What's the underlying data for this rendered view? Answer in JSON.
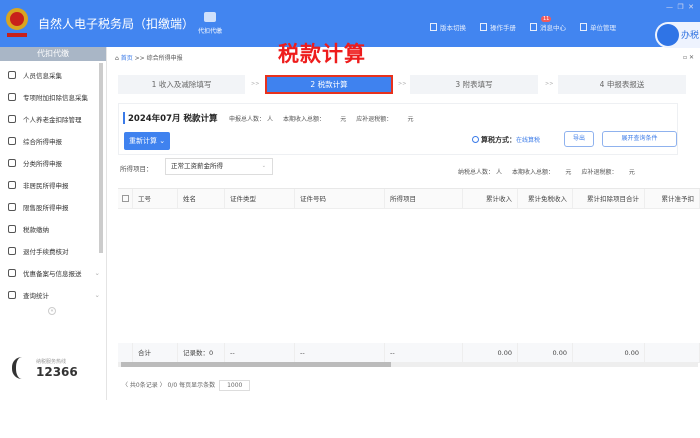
{
  "header": {
    "app_title": "自然人电子税务局（扣缴端）",
    "nav_button": "代扣代缴",
    "links": [
      "版本切换",
      "操作手册",
      "消息中心",
      "单位管理"
    ],
    "message_badge": "11",
    "chat_label": "办税",
    "brand_color": "#4285f0"
  },
  "sidebar": {
    "title": "代扣代缴",
    "items": [
      {
        "label": "人员信息采集",
        "icon": "person-icon"
      },
      {
        "label": "专项附加扣除信息采集",
        "icon": "list-icon"
      },
      {
        "label": "个人养老金扣除管理",
        "icon": "card-icon"
      },
      {
        "label": "综合所得申报",
        "icon": "layers-icon"
      },
      {
        "label": "分类所得申报",
        "icon": "pie-icon"
      },
      {
        "label": "非居民所得申报",
        "icon": "user-icon"
      },
      {
        "label": "限售股所得申报",
        "icon": "chart-icon"
      },
      {
        "label": "税款缴纳",
        "icon": "folder-icon"
      },
      {
        "label": "退付手续费核对",
        "icon": "book-icon"
      },
      {
        "label": "优惠备案与信息报送",
        "icon": "doc-icon"
      },
      {
        "label": "查询统计",
        "icon": "search-icon"
      }
    ],
    "hotline_label": "纳税服务热线",
    "hotline": "12366"
  },
  "breadcrumb": {
    "home": "首页",
    "sep": ">>",
    "current": "综合所得申报"
  },
  "overlay_title": "税款计算",
  "steps": [
    {
      "label": "1 收入及减除填写"
    },
    {
      "label": "2 税款计算",
      "active": true
    },
    {
      "label": "3 附表填写"
    },
    {
      "label": "4 申报表报送"
    }
  ],
  "step_sep": ">>",
  "info": {
    "period_title": "2024年07月  税款计算",
    "declare_count_label": "申报总人数：",
    "declare_count_unit": "人",
    "income_label": "本期收入总额：",
    "income_unit": "元",
    "tax_label": "应补退税额：",
    "tax_unit": "元",
    "recalc_button": "重新计算 ⌄",
    "method_label": "算税方式：",
    "method_value": "在线算税",
    "export_button": "导出",
    "expand_button": "展开查询条件"
  },
  "filter": {
    "label": "所得项目：",
    "value": "正常工资薪金所得"
  },
  "stats": {
    "taxpayers_label": "纳税总人数：",
    "taxpayers_unit": "人",
    "income_label": "本期收入总额：",
    "income_unit": "元",
    "tax_label": "应补退税额：",
    "tax_unit": "元"
  },
  "table": {
    "columns": [
      "工号",
      "姓名",
      "证件类型",
      "证件号码",
      "所得项目",
      "累计收入",
      "累计免税收入",
      "累计扣除项目合计",
      "累计准予扣"
    ],
    "summary": [
      "合计",
      "记录数：0",
      "--",
      "--",
      "--",
      "0.00",
      "0.00",
      "0.00",
      ""
    ]
  },
  "pager": {
    "text": "〈 共0条记录 〉 0/0  每页显示条数",
    "page_size": "1000"
  }
}
